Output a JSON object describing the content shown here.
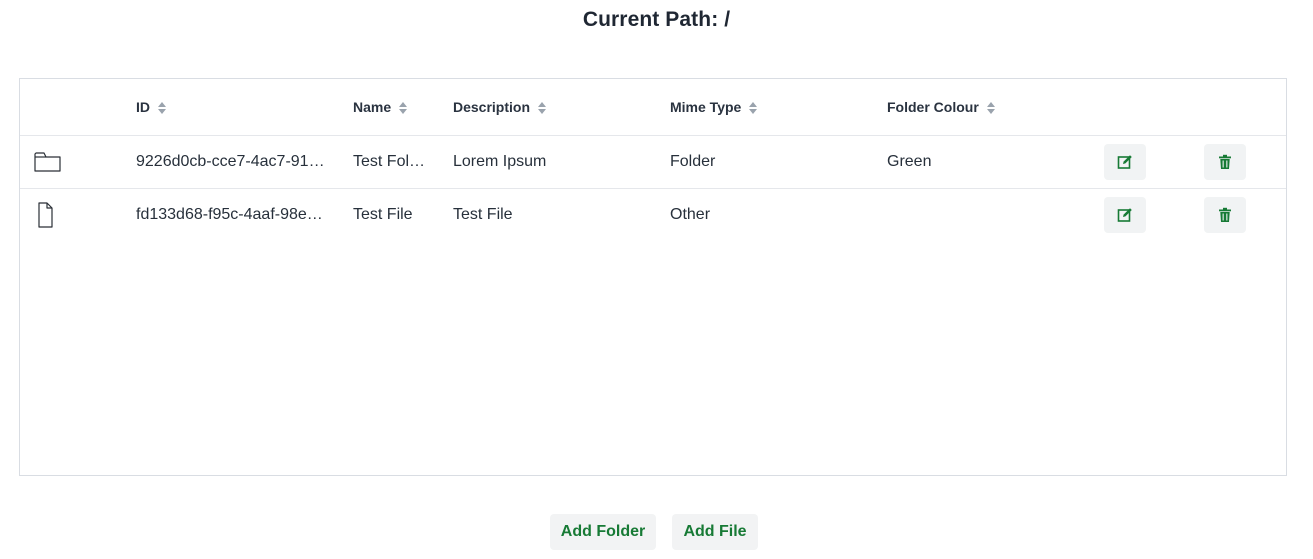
{
  "header": {
    "title": "Current Path: /"
  },
  "table": {
    "columns": [
      {
        "label": "ID"
      },
      {
        "label": "Name"
      },
      {
        "label": "Description"
      },
      {
        "label": "Mime Type"
      },
      {
        "label": "Folder Colour"
      }
    ],
    "rows": [
      {
        "icon": "folder-icon",
        "id": "9226d0cb-cce7-4ac7-91…",
        "name": "Test Fol…",
        "description": "Lorem Ipsum",
        "mime": "Folder",
        "colour": "Green"
      },
      {
        "icon": "file-icon",
        "id": "fd133d68-f95c-4aaf-98e…",
        "name": "Test File",
        "description": "Test File",
        "mime": "Other",
        "colour": ""
      }
    ]
  },
  "actions": {
    "add_folder": "Add Folder",
    "add_file": "Add File"
  },
  "colors": {
    "accent": "#177a35",
    "border": "#d9dde3",
    "button_bg": "#f2f3f4"
  }
}
